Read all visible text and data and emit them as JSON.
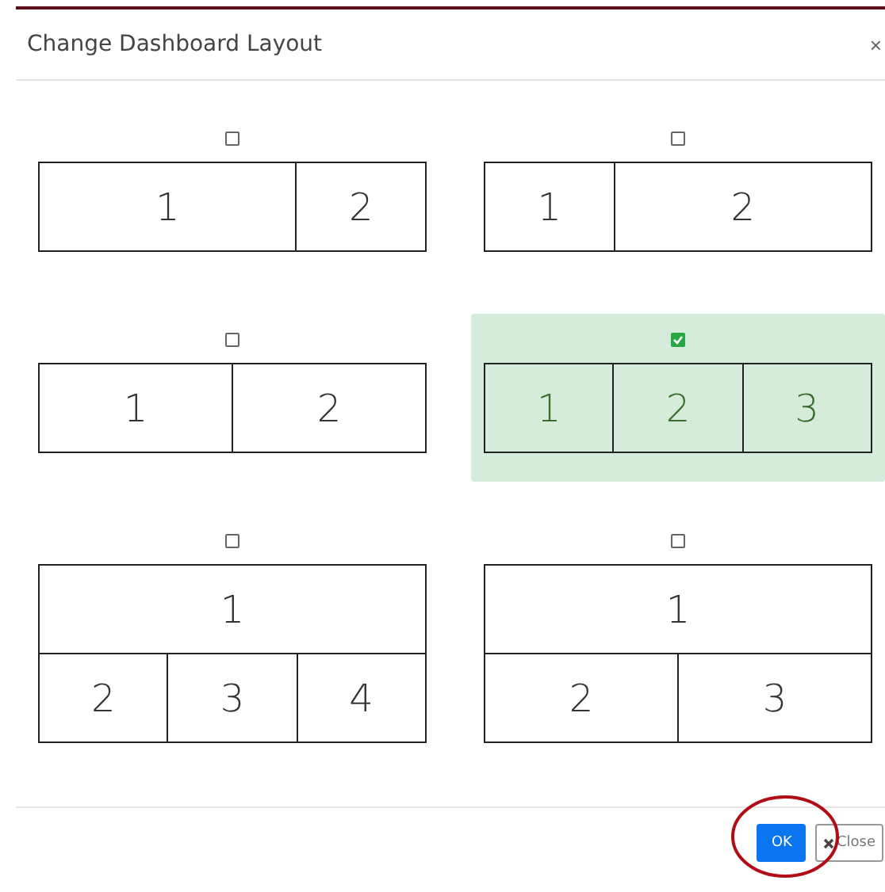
{
  "dialog": {
    "title": "Change Dashboard Layout",
    "close_icon": "×"
  },
  "layouts": [
    {
      "selected": false,
      "panels": [
        {
          "label": "1",
          "kind": "wide"
        },
        {
          "label": "2",
          "kind": "narrow"
        }
      ]
    },
    {
      "selected": false,
      "panels": [
        {
          "label": "1",
          "kind": "narrow"
        },
        {
          "label": "2",
          "kind": "wide"
        }
      ]
    },
    {
      "selected": false,
      "panels": [
        {
          "label": "1",
          "kind": "half"
        },
        {
          "label": "2",
          "kind": "half"
        }
      ]
    },
    {
      "selected": true,
      "panels": [
        {
          "label": "1",
          "kind": "third"
        },
        {
          "label": "2",
          "kind": "third"
        },
        {
          "label": "3",
          "kind": "third"
        }
      ]
    },
    {
      "selected": false,
      "panels": [
        {
          "label": "1",
          "kind": "full"
        },
        {
          "label": "2",
          "kind": "third"
        },
        {
          "label": "3",
          "kind": "third"
        },
        {
          "label": "4",
          "kind": "third"
        }
      ]
    },
    {
      "selected": false,
      "panels": [
        {
          "label": "1",
          "kind": "full"
        },
        {
          "label": "2",
          "kind": "half"
        },
        {
          "label": "3",
          "kind": "half"
        }
      ]
    }
  ],
  "buttons": [
    {
      "label": "OK",
      "kind": "primary"
    },
    {
      "label": "Close",
      "kind": "secondary"
    }
  ]
}
